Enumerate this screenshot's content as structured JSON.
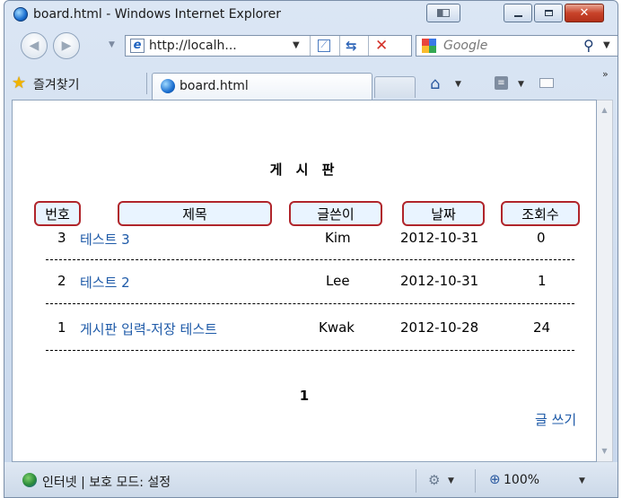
{
  "window": {
    "title": "board.html - Windows Internet Explorer"
  },
  "address": {
    "url": "http://localh...",
    "search_placeholder": "Google"
  },
  "favorites": {
    "label": "즐겨찾기"
  },
  "tab": {
    "label": "board.html"
  },
  "board": {
    "title": "게 시 판",
    "headers": [
      "번호",
      "제목",
      "글쓴이",
      "날짜",
      "조회수"
    ],
    "rows": [
      {
        "num": "3",
        "title": "테스트 3",
        "author": "Kim",
        "date": "2012-10-31",
        "views": "0"
      },
      {
        "num": "2",
        "title": "테스트 2",
        "author": "Lee",
        "date": "2012-10-31",
        "views": "1"
      },
      {
        "num": "1",
        "title": "게시판 입력-저장 테스트",
        "author": "Kwak",
        "date": "2012-10-28",
        "views": "24"
      }
    ],
    "page": "1",
    "write_label": "글 쓰기"
  },
  "status": {
    "zone": "인터넷 | 보호 모드: 설정",
    "zoom": "100%"
  },
  "colors": {
    "link": "#1e5aa8",
    "header_border": "#b0252b",
    "header_fill": "#e9f4ff",
    "close_button": "#c8432a"
  }
}
